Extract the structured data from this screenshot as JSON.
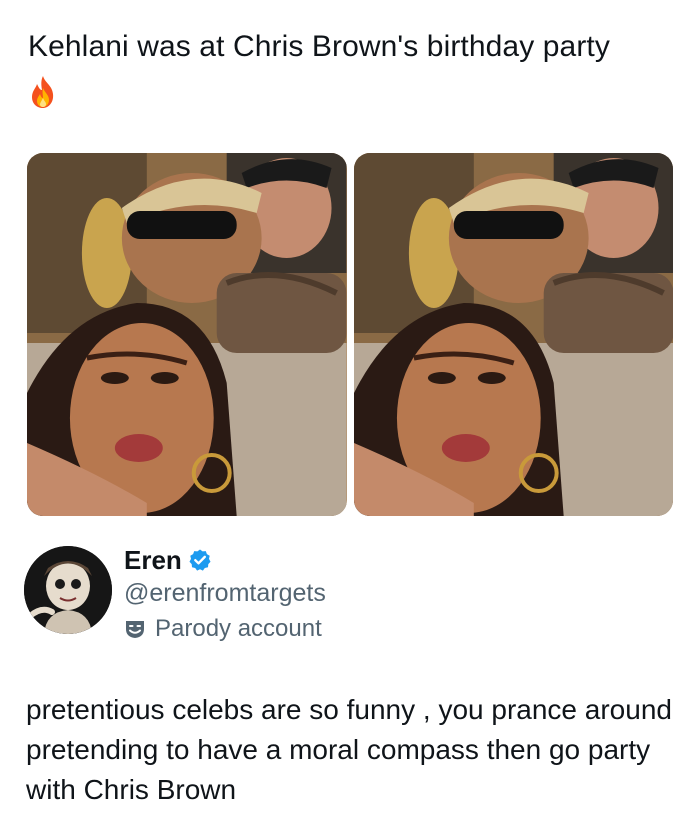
{
  "post": {
    "quoted_text": "Kehlani was at Chris Brown's birthday party",
    "emoji": "fire-icon",
    "photos": [
      {
        "icon": "party-photo"
      },
      {
        "icon": "party-photo"
      }
    ]
  },
  "author": {
    "display_name": "Eren",
    "verified": true,
    "handle": "@erenfromtargets",
    "label": "Parody account"
  },
  "reply": {
    "text": "pretentious celebs are so funny , you prance around pretending to have a moral compass then go party with Chris Brown"
  },
  "colors": {
    "text": "#0f1419",
    "muted": "#536471",
    "verified": "#1d9bf0",
    "background": "#ffffff"
  }
}
